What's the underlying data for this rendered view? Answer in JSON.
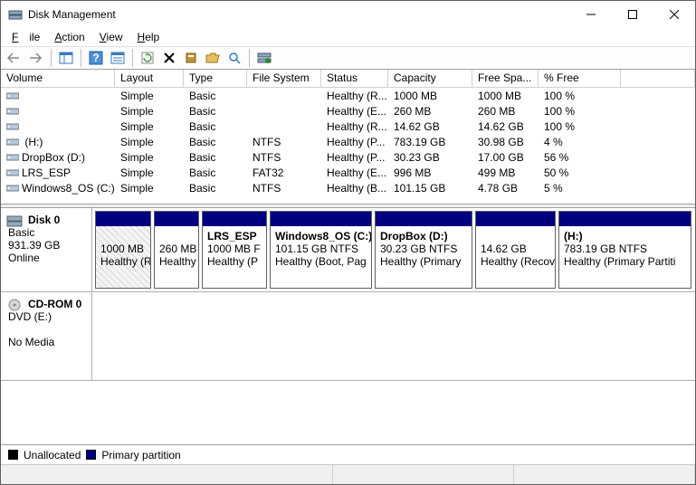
{
  "window": {
    "title": "Disk Management"
  },
  "menu": {
    "file": "File",
    "action": "Action",
    "view": "View",
    "help": "Help"
  },
  "headers": {
    "volume": "Volume",
    "layout": "Layout",
    "type": "Type",
    "fs": "File System",
    "status": "Status",
    "capacity": "Capacity",
    "free": "Free Spa...",
    "pct": "% Free"
  },
  "rows": [
    {
      "name": "",
      "layout": "Simple",
      "type": "Basic",
      "fs": "",
      "status": "Healthy (R...",
      "cap": "1000 MB",
      "free": "1000 MB",
      "pct": "100 %",
      "selected": true
    },
    {
      "name": "",
      "layout": "Simple",
      "type": "Basic",
      "fs": "",
      "status": "Healthy (E...",
      "cap": "260 MB",
      "free": "260 MB",
      "pct": "100 %"
    },
    {
      "name": "",
      "layout": "Simple",
      "type": "Basic",
      "fs": "",
      "status": "Healthy (R...",
      "cap": "14.62 GB",
      "free": "14.62 GB",
      "pct": "100 %"
    },
    {
      "name": " (H:)",
      "layout": "Simple",
      "type": "Basic",
      "fs": "NTFS",
      "status": "Healthy (P...",
      "cap": "783.19 GB",
      "free": "30.98 GB",
      "pct": "4 %"
    },
    {
      "name": "DropBox (D:)",
      "layout": "Simple",
      "type": "Basic",
      "fs": "NTFS",
      "status": "Healthy (P...",
      "cap": "30.23 GB",
      "free": "17.00 GB",
      "pct": "56 %"
    },
    {
      "name": "LRS_ESP",
      "layout": "Simple",
      "type": "Basic",
      "fs": "FAT32",
      "status": "Healthy (E...",
      "cap": "996 MB",
      "free": "499 MB",
      "pct": "50 %"
    },
    {
      "name": "Windows8_OS (C:)",
      "layout": "Simple",
      "type": "Basic",
      "fs": "NTFS",
      "status": "Healthy (B...",
      "cap": "101.15 GB",
      "free": "4.78 GB",
      "pct": "5 %"
    }
  ],
  "disk0": {
    "title": "Disk 0",
    "type": "Basic",
    "size": "931.39 GB",
    "state": "Online"
  },
  "parts": [
    {
      "title": "",
      "l1": "1000 MB",
      "l2": "Healthy (R",
      "w": 62,
      "hatch": true
    },
    {
      "title": "",
      "l1": "260 MB",
      "l2": "Healthy (",
      "w": 50
    },
    {
      "title": "LRS_ESP",
      "l1": "1000 MB F",
      "l2": "Healthy (P",
      "w": 72
    },
    {
      "title": "Windows8_OS  (C:)",
      "l1": "101.15 GB NTFS",
      "l2": "Healthy (Boot, Pag",
      "w": 113
    },
    {
      "title": "DropBox  (D:)",
      "l1": "30.23 GB NTFS",
      "l2": "Healthy (Primary ",
      "w": 108
    },
    {
      "title": "",
      "l1": "14.62 GB",
      "l2": "Healthy (Recov",
      "w": 89
    },
    {
      "title": " (H:)",
      "l1": "783.19 GB NTFS",
      "l2": "Healthy (Primary Partiti",
      "w": 147
    }
  ],
  "cdrom": {
    "title": "CD-ROM 0",
    "type": "DVD (E:)",
    "state": "No Media"
  },
  "legend": {
    "unalloc": "Unallocated",
    "primary": "Primary partition"
  }
}
